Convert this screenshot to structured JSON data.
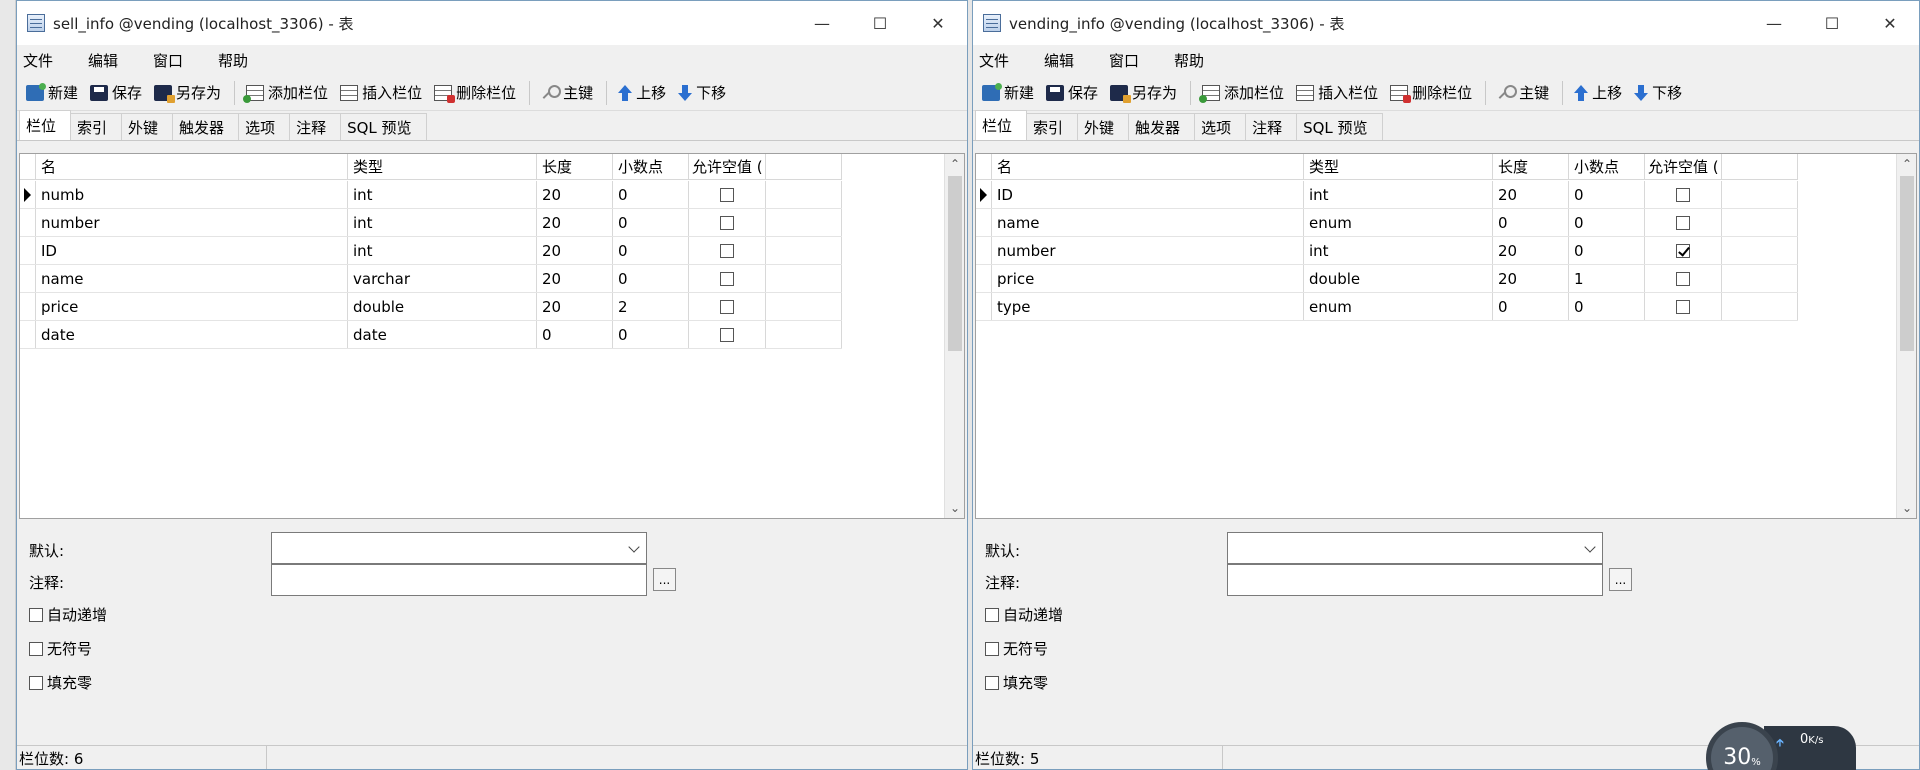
{
  "left_window": {
    "title": "sell_info @vending (localhost_3306) - 表",
    "menu": [
      "文件",
      "编辑",
      "窗口",
      "帮助"
    ],
    "toolbar": {
      "new": "新建",
      "save": "保存",
      "save_as": "另存为",
      "add_field": "添加栏位",
      "insert_field": "插入栏位",
      "delete_field": "删除栏位",
      "primary_key": "主键",
      "move_up": "上移",
      "move_down": "下移"
    },
    "tabs": [
      "栏位",
      "索引",
      "外键",
      "触发器",
      "选项",
      "注释",
      "SQL 预览"
    ],
    "columns": [
      "名",
      "类型",
      "长度",
      "小数点",
      "允许空值 ("
    ],
    "rows": [
      {
        "name": "numb",
        "type": "int",
        "length": "20",
        "decimals": "0",
        "nullable": false
      },
      {
        "name": "number",
        "type": "int",
        "length": "20",
        "decimals": "0",
        "nullable": false
      },
      {
        "name": "ID",
        "type": "int",
        "length": "20",
        "decimals": "0",
        "nullable": false
      },
      {
        "name": "name",
        "type": "varchar",
        "length": "20",
        "decimals": "0",
        "nullable": false
      },
      {
        "name": "price",
        "type": "double",
        "length": "20",
        "decimals": "2",
        "nullable": false
      },
      {
        "name": "date",
        "type": "date",
        "length": "0",
        "decimals": "0",
        "nullable": false
      }
    ],
    "props": {
      "default_label": "默认:",
      "comment_label": "注释:",
      "auto_increment": "自动递增",
      "unsigned": "无符号",
      "zerofill": "填充零",
      "ellipsis": "..."
    },
    "status": "栏位数: 6"
  },
  "right_window": {
    "title": "vending_info @vending (localhost_3306) - 表",
    "menu": [
      "文件",
      "编辑",
      "窗口",
      "帮助"
    ],
    "toolbar": {
      "new": "新建",
      "save": "保存",
      "save_as": "另存为",
      "add_field": "添加栏位",
      "insert_field": "插入栏位",
      "delete_field": "删除栏位",
      "primary_key": "主键",
      "move_up": "上移",
      "move_down": "下移"
    },
    "tabs": [
      "栏位",
      "索引",
      "外键",
      "触发器",
      "选项",
      "注释",
      "SQL 预览"
    ],
    "columns": [
      "名",
      "类型",
      "长度",
      "小数点",
      "允许空值 ("
    ],
    "rows": [
      {
        "name": "ID",
        "type": "int",
        "length": "20",
        "decimals": "0",
        "nullable": false
      },
      {
        "name": "name",
        "type": "enum",
        "length": "0",
        "decimals": "0",
        "nullable": false
      },
      {
        "name": "number",
        "type": "int",
        "length": "20",
        "decimals": "0",
        "nullable": true
      },
      {
        "name": "price",
        "type": "double",
        "length": "20",
        "decimals": "1",
        "nullable": false
      },
      {
        "name": "type",
        "type": "enum",
        "length": "0",
        "decimals": "0",
        "nullable": false
      }
    ],
    "props": {
      "default_label": "默认:",
      "comment_label": "注释:",
      "auto_increment": "自动递增",
      "unsigned": "无符号",
      "zerofill": "填充零",
      "ellipsis": "..."
    },
    "status": "栏位数: 5"
  },
  "widget": {
    "cpu": "30",
    "cpu_unit": "%",
    "net_up": "0",
    "net_unit": "K/s"
  }
}
